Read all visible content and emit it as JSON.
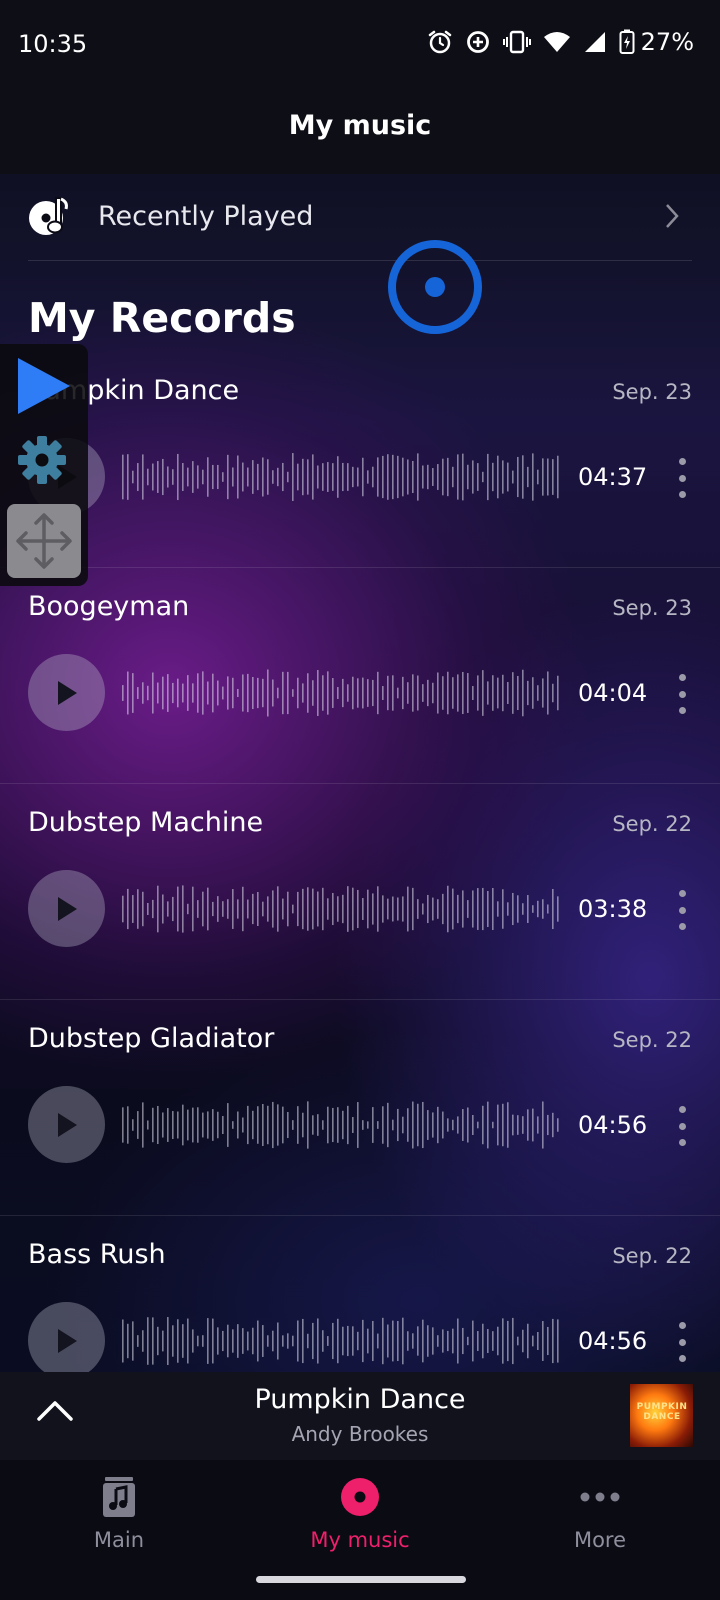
{
  "status_bar": {
    "time": "10:35",
    "battery": "27%",
    "icons": [
      "alarm-icon",
      "data-saver-icon",
      "vibrate-icon",
      "wifi-icon",
      "cell-signal-icon",
      "battery-charging-icon"
    ]
  },
  "header": {
    "title": "My music"
  },
  "recent": {
    "label": "Recently Played"
  },
  "section_title": "My Records",
  "records": [
    {
      "title": "Pumpkin Dance",
      "date": "Sep. 23",
      "duration": "04:37"
    },
    {
      "title": "Boogeyman",
      "date": "Sep. 23",
      "duration": "04:04"
    },
    {
      "title": "Dubstep Machine",
      "date": "Sep. 22",
      "duration": "03:38"
    },
    {
      "title": "Dubstep Gladiator",
      "date": "Sep. 22",
      "duration": "04:56"
    },
    {
      "title": "Bass Rush",
      "date": "Sep. 22",
      "duration": "04:56"
    }
  ],
  "mini_player": {
    "title": "Pumpkin Dance",
    "artist": "Andy Brookes",
    "art_text": "PUMPKIN DANCE"
  },
  "nav": [
    {
      "label": "Main",
      "icon": "music-note-icon",
      "active": false
    },
    {
      "label": "My music",
      "icon": "record-icon",
      "active": true
    },
    {
      "label": "More",
      "icon": "more-horizontal-icon",
      "active": false
    }
  ],
  "colors": {
    "accent": "#ee1f6b",
    "touch_indicator": "#1565d8",
    "overlay_play": "#2f7df6",
    "overlay_gear": "#3e7f9f"
  }
}
